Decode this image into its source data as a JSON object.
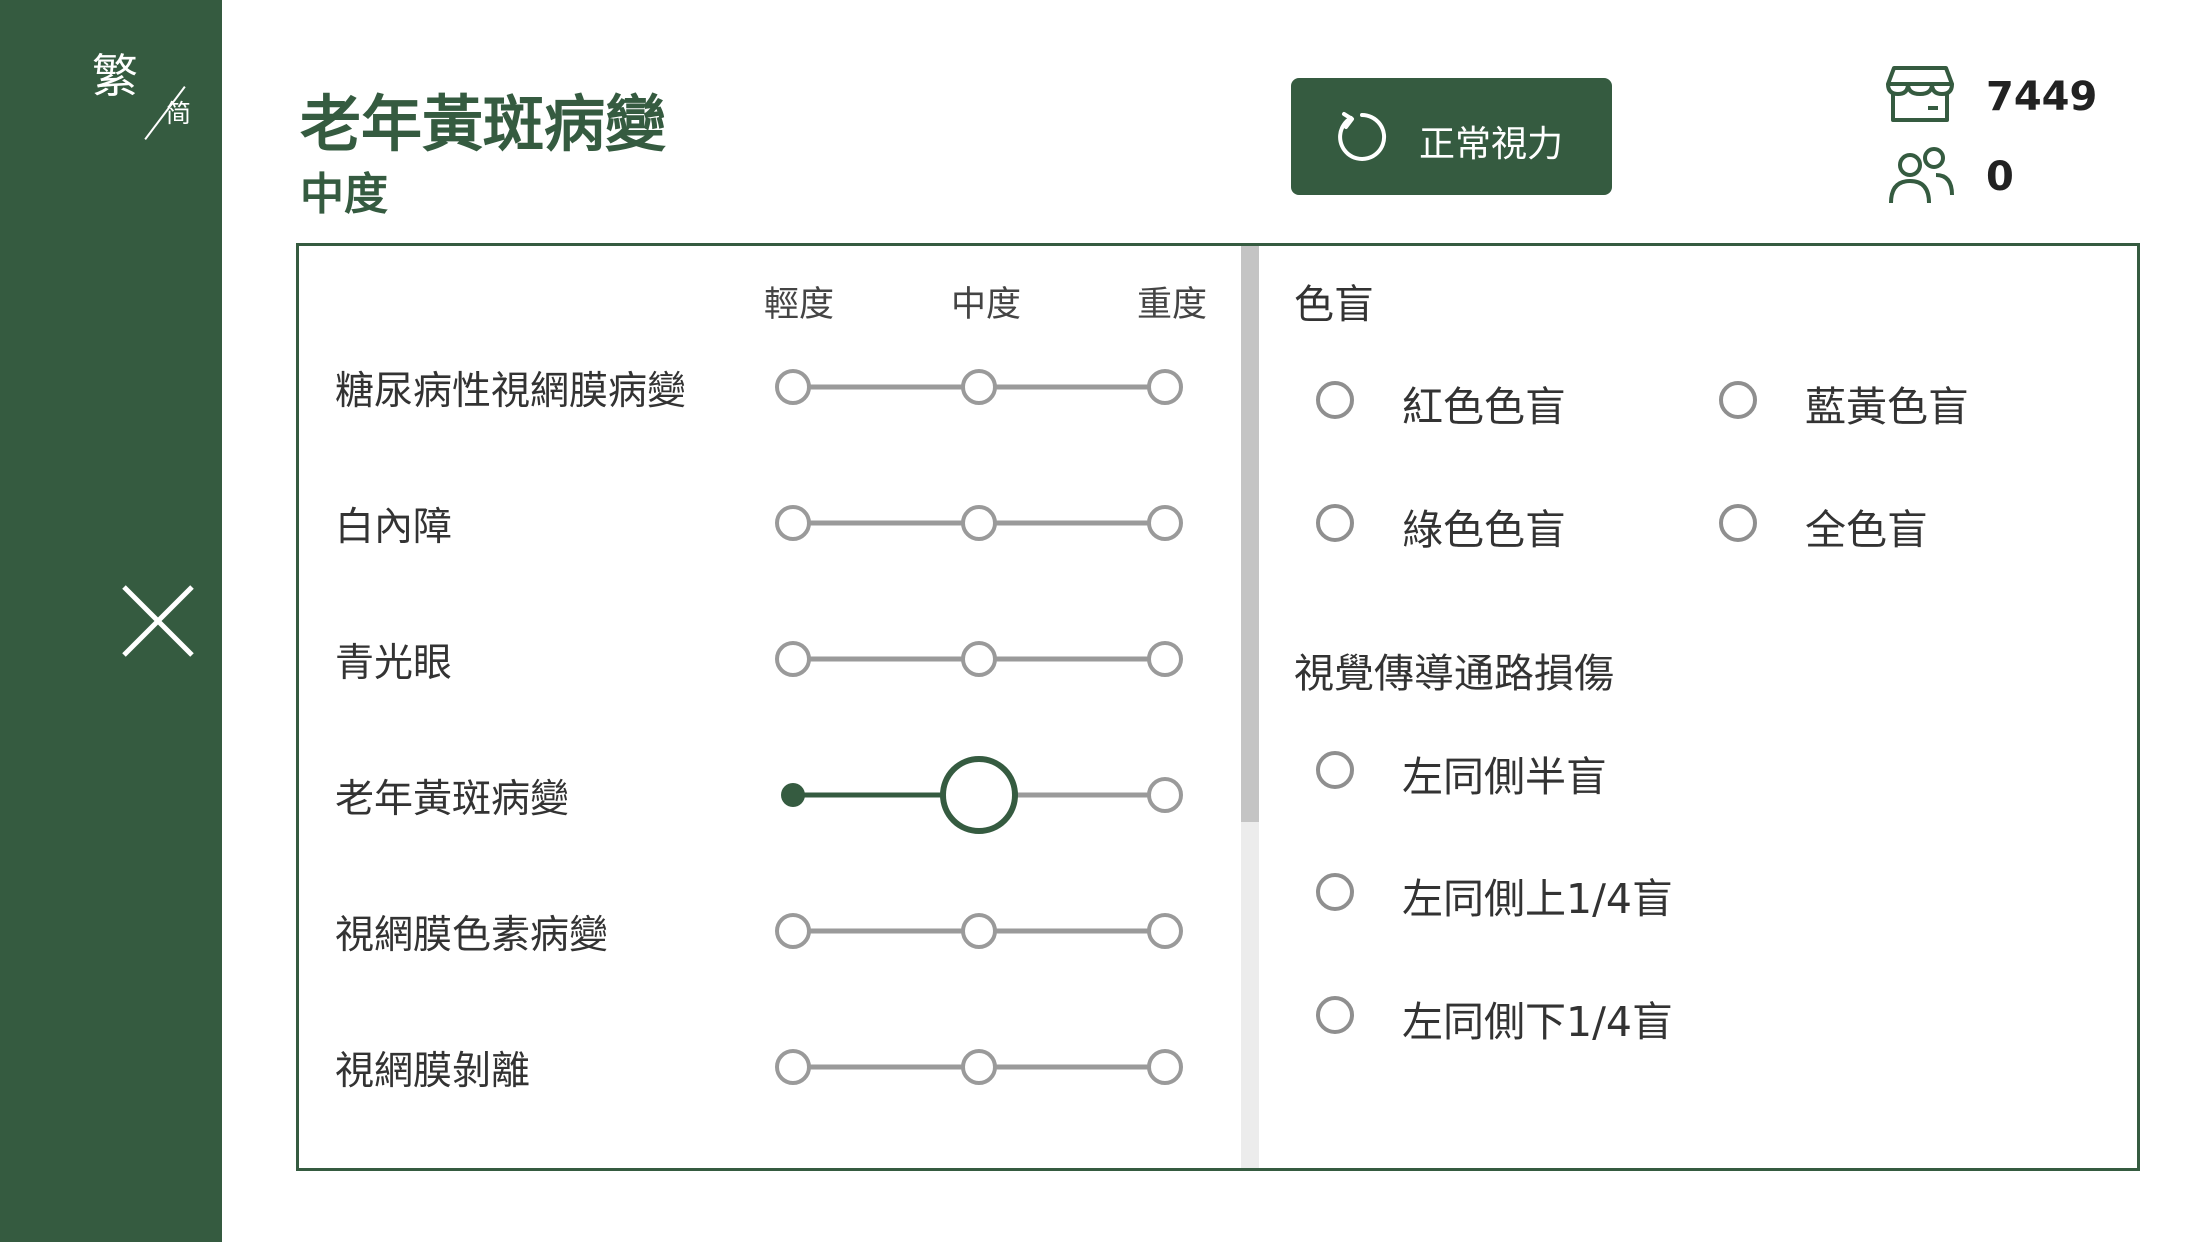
{
  "sidebar": {
    "lang_traditional": "繁",
    "lang_simplified": "简"
  },
  "header": {
    "title": "老年黃斑病變",
    "subtitle": "中度",
    "normal_vision_label": "正常視力",
    "stock_count": "7449",
    "users_count": "0"
  },
  "severity_headers": [
    "輕度",
    "中度",
    "重度"
  ],
  "conditions": [
    {
      "label": "糖尿病性視網膜病變",
      "level": null
    },
    {
      "label": "白內障",
      "level": null
    },
    {
      "label": "青光眼",
      "level": null
    },
    {
      "label": "老年黃斑病變",
      "level": 2
    },
    {
      "label": "視網膜色素病變",
      "level": null
    },
    {
      "label": "視網膜剝離",
      "level": null
    }
  ],
  "color_blind": {
    "title": "色盲",
    "options": [
      "紅色色盲",
      "藍黃色盲",
      "綠色色盲",
      "全色盲"
    ]
  },
  "visual_pathway": {
    "title": "視覺傳導通路損傷",
    "options": [
      "左同側半盲",
      "左同側上1/4盲",
      "左同側下1/4盲"
    ]
  },
  "colors": {
    "accent": "#355b40",
    "track": "#9a9a9a"
  }
}
